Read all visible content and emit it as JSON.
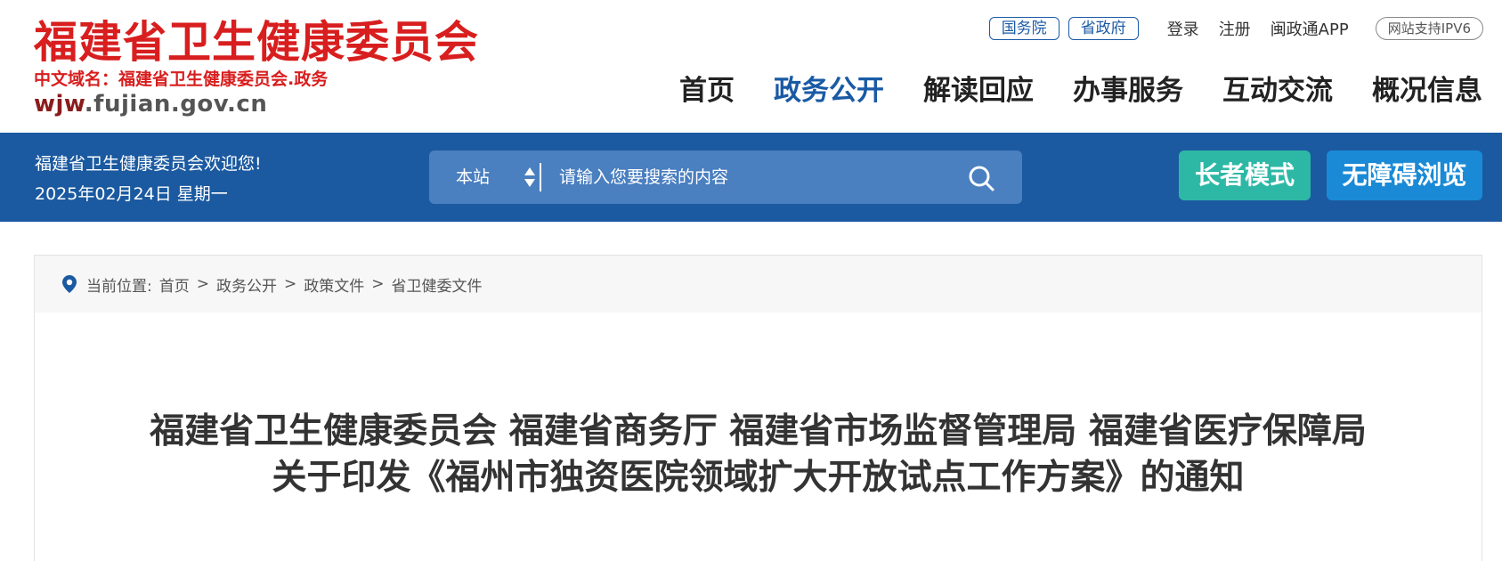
{
  "header": {
    "logo_title": "福建省卫生健康委员会",
    "logo_domain": "中文域名：福建省卫生健康委员会.政务",
    "logo_url_bold": "wjw",
    "logo_url_rest": ".fujian.gov.cn",
    "top_pills": [
      "国务院",
      "省政府"
    ],
    "top_links": [
      "登录",
      "注册",
      "闽政通APP"
    ],
    "ipv6_badge": "网站支持IPV6",
    "nav": [
      "首页",
      "政务公开",
      "解读回应",
      "办事服务",
      "互动交流",
      "概况信息"
    ],
    "nav_active_index": 1
  },
  "band": {
    "welcome": "福建省卫生健康委员会欢迎您!",
    "date": "2025年02月24日 星期一",
    "search_scope": "本站",
    "search_placeholder": "请输入您要搜索的内容",
    "elder_mode": "长者模式",
    "accessible_mode": "无障碍浏览"
  },
  "breadcrumb": {
    "prefix": "当前位置:",
    "items": [
      "首页",
      "政务公开",
      "政策文件",
      "省卫健委文件"
    ],
    "separator": ">"
  },
  "article": {
    "title_line1": "福建省卫生健康委员会 福建省商务厅 福建省市场监督管理局 福建省医疗保障局",
    "title_line2": "关于印发《福州市独资医院领域扩大开放试点工作方案》的通知"
  },
  "colors": {
    "brand_red": "#d81e1e",
    "brand_blue": "#1b5aa0",
    "elder_green": "#2db8a6",
    "access_blue": "#1a8ad6"
  }
}
